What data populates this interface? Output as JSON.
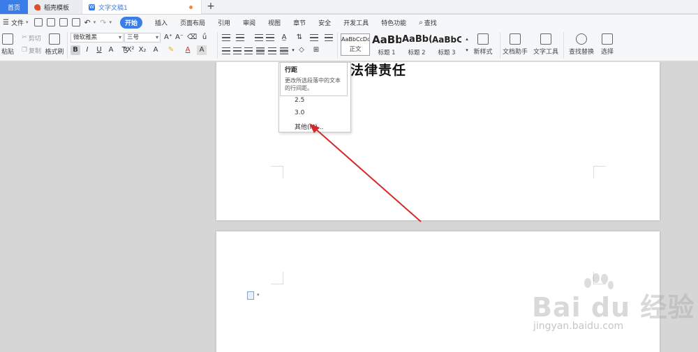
{
  "tabs": {
    "home": "首页",
    "templates": "稻壳模板",
    "document": "文字文稿1",
    "new_tab": "+"
  },
  "menu": {
    "file": "文件",
    "items": [
      "开始",
      "插入",
      "页面布局",
      "引用",
      "审阅",
      "视图",
      "章节",
      "安全",
      "开发工具",
      "特色功能"
    ],
    "search": "查找"
  },
  "ribbon": {
    "paste": "粘贴",
    "cut": "剪切",
    "copy": "复制",
    "format_painter": "格式刷",
    "font_name": "微软雅黑",
    "font_size": "三号",
    "styles": [
      {
        "sample": "AaBbCcDd",
        "name": "正文"
      },
      {
        "sample": "AaBb",
        "name": "标题 1"
      },
      {
        "sample": "AaBb(",
        "name": "标题 2"
      },
      {
        "sample": "AaBbC(",
        "name": "标题 3"
      }
    ],
    "new_style": "新样式",
    "doc_assistant": "文档助手",
    "text_tools": "文字工具",
    "find_replace": "查找替换",
    "select": "选择"
  },
  "document": {
    "heading_partial": "法律责任"
  },
  "line_spacing_dropdown": {
    "tooltip_title": "行距",
    "tooltip_desc": "更改所选段落中的文本的行间距。",
    "options": [
      "2.5",
      "3.0"
    ],
    "other": "其他(M)..."
  },
  "watermark": {
    "brand": "Bai du 经验",
    "url": "jingyan.baidu.com"
  },
  "colors": {
    "accent": "#3b7de8",
    "arrow": "#d42a2a"
  }
}
